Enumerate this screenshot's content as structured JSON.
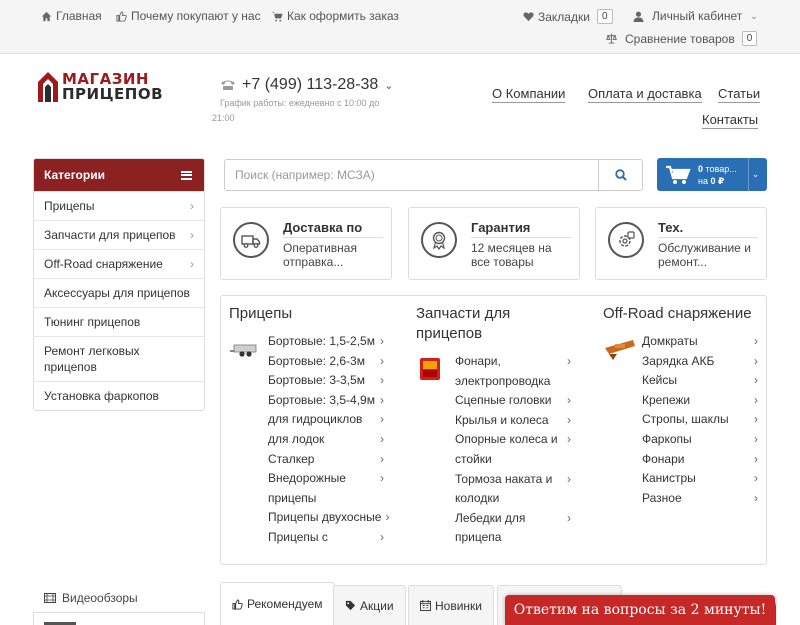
{
  "topbar": {
    "home": "Главная",
    "why": "Почему покупают у нас",
    "how": "Как оформить заказ",
    "bookmarks": "Закладки",
    "bookmarks_count": "0",
    "account": "Личный кабинет",
    "compare": "Сравнение товаров",
    "compare_count": "0"
  },
  "logo": {
    "line1": "МАГАЗИН",
    "line2": "ПРИЦЕПОВ"
  },
  "header": {
    "phone": "+7 (499) 113-28-38",
    "hours": "График работы: ежедневно с 10:00 до 21:00",
    "nav": [
      "О Компании",
      "Оплата и доставка",
      "Статьи",
      "Контакты"
    ]
  },
  "categories": {
    "title": "Категории",
    "items": [
      {
        "label": "Прицепы",
        "chev": "›"
      },
      {
        "label": "Запчасти для прицепов",
        "chev": "›"
      },
      {
        "label": "Off-Road снаряжение",
        "chev": "›"
      },
      {
        "label": "Аксессуары для прицепов",
        "chev": ""
      },
      {
        "label": "Тюнинг прицепов",
        "chev": ""
      },
      {
        "label": "Ремонт легковых прицепов",
        "chev": ""
      },
      {
        "label": "Установка фаркопов",
        "chev": ""
      }
    ]
  },
  "search": {
    "placeholder": "Поиск (например: МСЗА)"
  },
  "cart": {
    "line1_count": "0",
    "line1_text": "товар...",
    "line2_prefix": "на",
    "line2_sum": "0 ₽"
  },
  "features": [
    {
      "title": "Доставка по",
      "desc": "Оперативная отправка..."
    },
    {
      "title": "Гарантия",
      "desc": "12 месяцев на все товары"
    },
    {
      "title": "Тех.",
      "desc": "Обслуживание и ремонт..."
    }
  ],
  "menu": {
    "col1": {
      "title": "Прицепы",
      "items": [
        {
          "label": "Бортовые: 1,5-2,5м",
          "chev": "›"
        },
        {
          "label": "Бортовые: 2,6-3м",
          "chev": "›"
        },
        {
          "label": "Бортовые: 3-3,5м",
          "chev": "›"
        },
        {
          "label": "Бортовые: 3,5-4,9м",
          "chev": "›"
        },
        {
          "label": "для гидроциклов",
          "chev": "›"
        },
        {
          "label": "для лодок",
          "chev": "›"
        },
        {
          "label": "Сталкер",
          "chev": "›"
        },
        {
          "label": "Внедорожные",
          "chev": "›"
        },
        {
          "label": "прицепы",
          "chev": ""
        },
        {
          "label": "Прицепы двухосные",
          "chev": "›"
        },
        {
          "label": "Прицепы с",
          "chev": "›"
        }
      ]
    },
    "col2": {
      "title": "Запчасти для прицепов",
      "items": [
        {
          "label": "Фонари,",
          "chev": "›"
        },
        {
          "label": "электропроводка",
          "chev": ""
        },
        {
          "label": "Сцепные головки",
          "chev": "›"
        },
        {
          "label": "Крылья и колеса",
          "chev": "›"
        },
        {
          "label": "Опорные колеса и",
          "chev": "›"
        },
        {
          "label": "стойки",
          "chev": ""
        },
        {
          "label": "Тормоза наката и",
          "chev": "›"
        },
        {
          "label": "колодки",
          "chev": ""
        },
        {
          "label": "Лебедки для",
          "chev": "›"
        },
        {
          "label": "прицепа",
          "chev": ""
        }
      ]
    },
    "col3": {
      "title": "Off-Road снаряжение",
      "items": [
        {
          "label": "Домкраты",
          "chev": "›"
        },
        {
          "label": "Зарядка АКБ",
          "chev": "›"
        },
        {
          "label": "Кейсы",
          "chev": "›"
        },
        {
          "label": "Крепежи",
          "chev": "›"
        },
        {
          "label": "Стропы, шаклы",
          "chev": "›"
        },
        {
          "label": "Фаркопы",
          "chev": "›"
        },
        {
          "label": "Фонари",
          "chev": "›"
        },
        {
          "label": "Канистры",
          "chev": "›"
        },
        {
          "label": "Разное",
          "chev": "›"
        }
      ]
    }
  },
  "bottom": {
    "video": "Видеообзоры",
    "tabs": [
      "Рекомендуем",
      "Акции",
      "Новинки"
    ],
    "chat": "Ответим на вопросы за 2 минуты!"
  },
  "colors": {
    "brand_red": "#8b2121",
    "cart_blue": "#2a6fb5",
    "chat_red": "#c62828"
  }
}
